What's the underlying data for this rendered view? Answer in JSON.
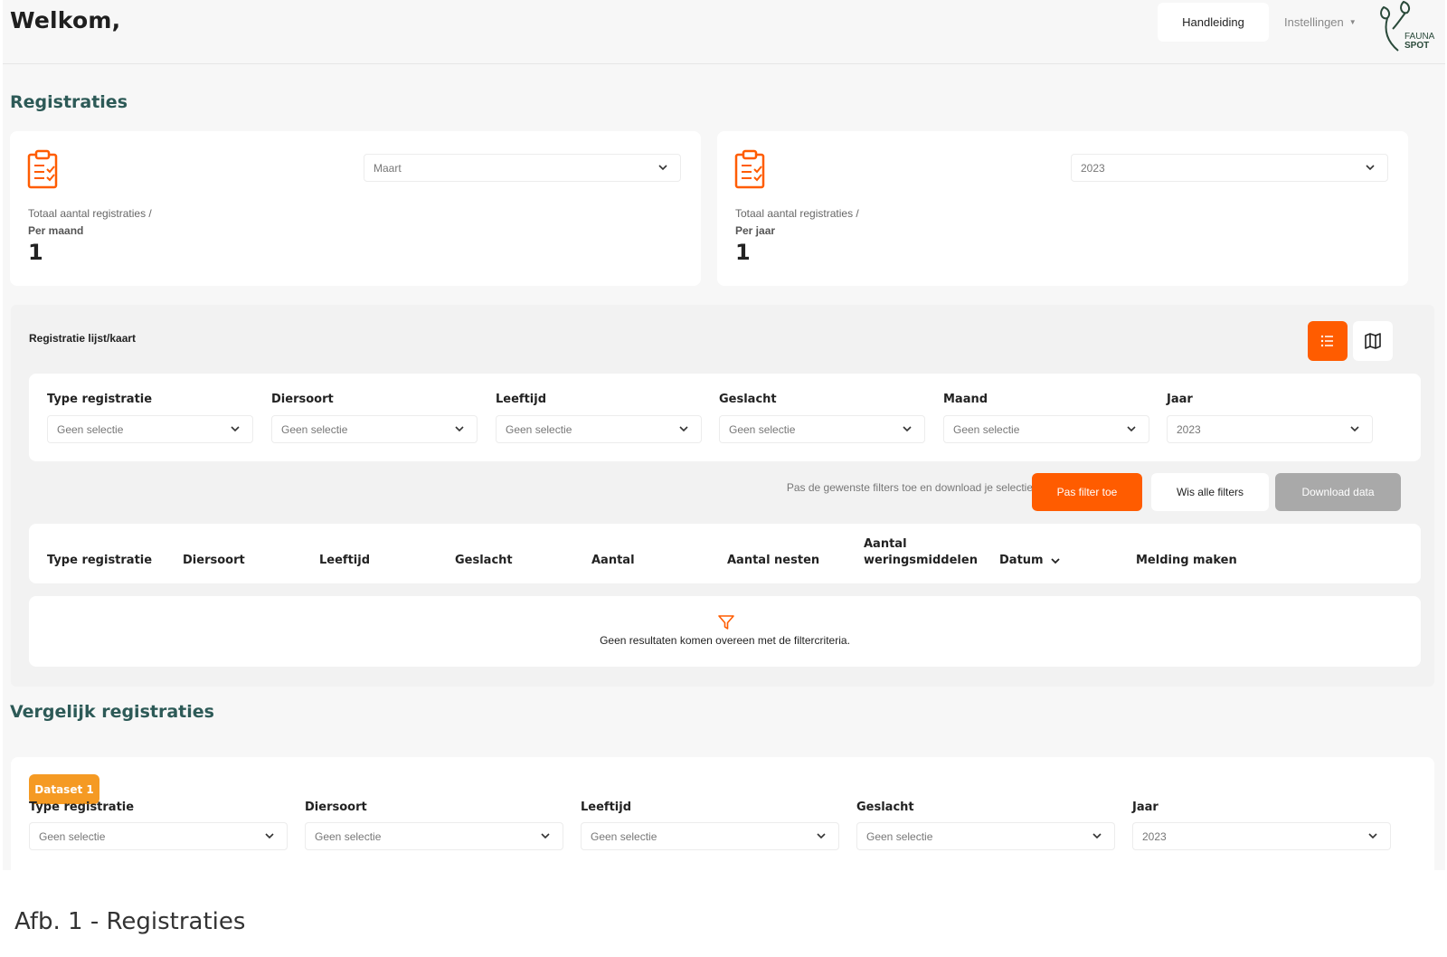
{
  "header": {
    "welcome": "Welkom,",
    "manual_label": "Handleiding",
    "settings_label": "Instellingen",
    "logo_text_1": "FAUNA",
    "logo_text_2": "SPOT"
  },
  "registraties": {
    "title": "Registraties",
    "month_card": {
      "select_value": "Maart",
      "label": "Totaal aantal registraties /",
      "sub": "Per maand",
      "value": "1"
    },
    "year_card": {
      "select_value": "2023",
      "label": "Totaal aantal registraties /",
      "sub": "Per jaar",
      "value": "1"
    }
  },
  "list_panel": {
    "title": "Registratie lijst/kaart",
    "filters": [
      {
        "label": "Type registratie",
        "value": "Geen selectie"
      },
      {
        "label": "Diersoort",
        "value": "Geen selectie"
      },
      {
        "label": "Leeftijd",
        "value": "Geen selectie"
      },
      {
        "label": "Geslacht",
        "value": "Geen selectie"
      },
      {
        "label": "Maand",
        "value": "Geen selectie"
      },
      {
        "label": "Jaar",
        "value": "2023"
      }
    ],
    "hint": "Pas de gewenste filters toe en download je selectie",
    "apply_label": "Pas filter toe",
    "clear_label": "Wis alle filters",
    "download_label": "Download data",
    "columns": [
      "Type registratie",
      "Diersoort",
      "Leeftijd",
      "Geslacht",
      "Aantal",
      "Aantal nesten",
      "Aantal",
      "weringsmiddelen",
      "Datum",
      "Melding maken"
    ],
    "empty_text": "Geen resultaten komen overeen met de filtercriteria."
  },
  "compare": {
    "title": "Vergelijk registraties",
    "badge": "Dataset 1",
    "filters": [
      {
        "label": "Type registratie",
        "value": "Geen selectie"
      },
      {
        "label": "Diersoort",
        "value": "Geen selectie"
      },
      {
        "label": "Leeftijd",
        "value": "Geen selectie"
      },
      {
        "label": "Geslacht",
        "value": "Geen selectie"
      },
      {
        "label": "Jaar",
        "value": "2023"
      }
    ]
  },
  "caption": "Afb. 1 - Registraties",
  "colors": {
    "accent": "#ff5c00",
    "title": "#2d5a57",
    "badge": "#f59a23"
  },
  "icons": [
    "clipboard-icon",
    "chevron-down-icon",
    "list-icon",
    "map-icon",
    "filter-icon",
    "fauna-spot-logo"
  ]
}
